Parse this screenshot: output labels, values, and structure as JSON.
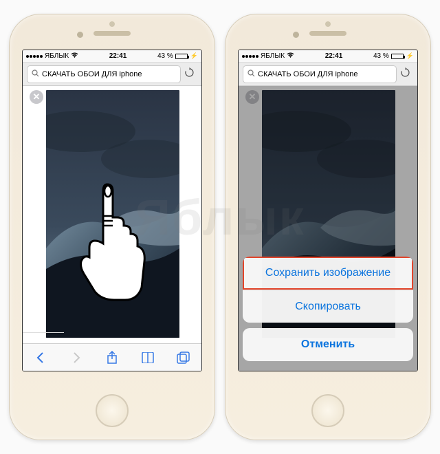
{
  "watermark": "Яблык",
  "status": {
    "carrier": "ЯБЛЫК",
    "time": "22:41",
    "battery_text": "43 %"
  },
  "search": {
    "query": "СКАЧАТЬ ОБОИ ДЛЯ iphone"
  },
  "actionsheet": {
    "save": "Сохранить изображение",
    "copy": "Скопировать",
    "cancel": "Отменить"
  },
  "toolbar_icons": {
    "back": "back-icon",
    "forward": "forward-icon",
    "share": "share-icon",
    "bookmarks": "bookmarks-icon",
    "tabs": "tabs-icon"
  },
  "close_label": "✕"
}
